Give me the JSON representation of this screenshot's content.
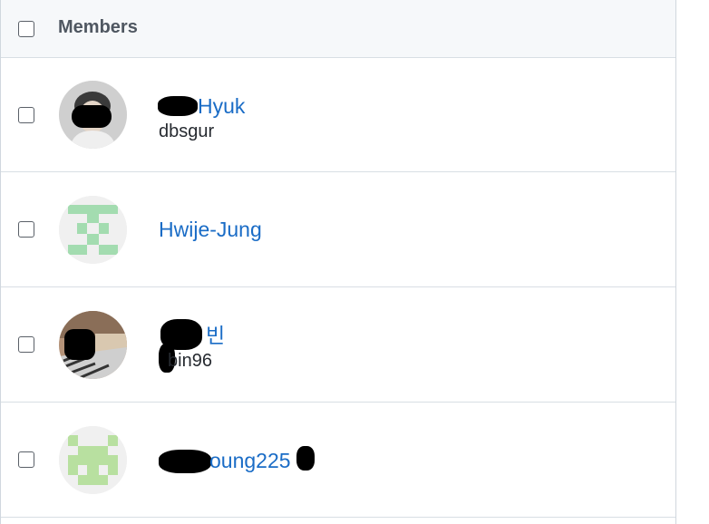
{
  "header": {
    "title": "Members"
  },
  "members": [
    {
      "name": "Hyuk",
      "login": "dbsgur",
      "avatar": "photo"
    },
    {
      "name": "Hwije-Jung",
      "login": "",
      "avatar": "identicon",
      "identicon_color": "#a3dcb0"
    },
    {
      "name": "빈",
      "login": "bin96",
      "avatar": "photo"
    },
    {
      "name": "oung225",
      "login": "",
      "avatar": "identicon",
      "identicon_color": "#b8e0a0"
    }
  ]
}
